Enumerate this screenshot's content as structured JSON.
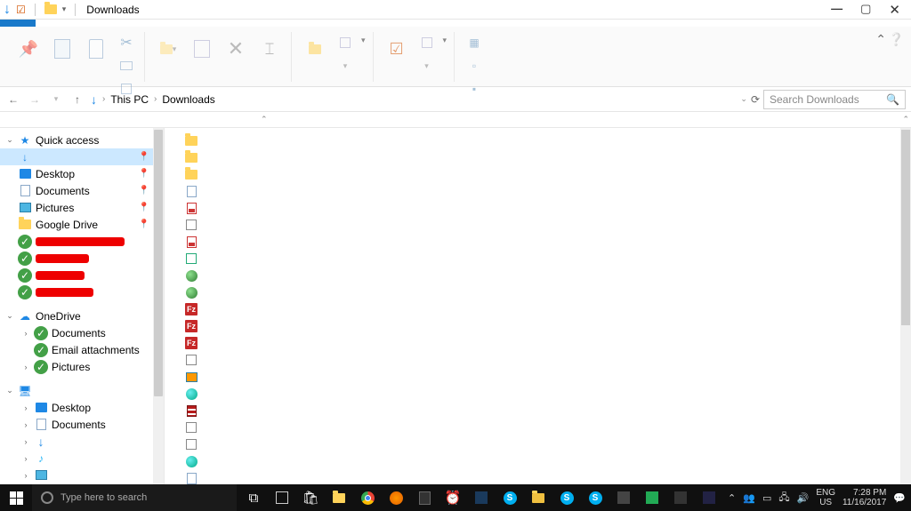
{
  "window": {
    "title": "Downloads"
  },
  "breadcrumb": {
    "root": "This PC",
    "current": "Downloads"
  },
  "search": {
    "placeholder": "Search Downloads"
  },
  "nav": {
    "quickAccess": {
      "label": "Quick access",
      "downloads": "",
      "desktop": "Desktop",
      "documents": "Documents",
      "pictures": "Pictures",
      "googleDrive": "Google Drive"
    },
    "oneDrive": {
      "label": "OneDrive",
      "documents": "Documents",
      "emailAttachments": "Email attachments",
      "pictures": "Pictures"
    },
    "thisPC": {
      "label": "",
      "desktop": "Desktop",
      "documents": "Documents",
      "downloads": "",
      "music": ""
    }
  },
  "cortana": {
    "placeholder": "Type here to search"
  },
  "tray": {
    "lang1": "ENG",
    "lang2": "US",
    "time": "7:28 PM",
    "date": "11/16/2017"
  }
}
